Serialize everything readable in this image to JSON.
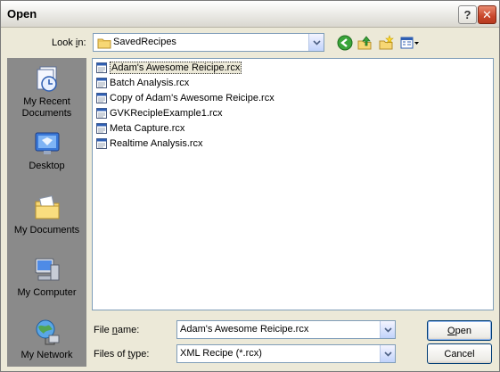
{
  "window": {
    "title": "Open",
    "help_glyph": "?",
    "close_glyph": "✕"
  },
  "look_in": {
    "label_pre": "Look ",
    "label_hot": "i",
    "label_post": "n:",
    "value": "SavedRecipes",
    "icon": "folder-icon"
  },
  "toolbar": {
    "icons": [
      "back-icon",
      "up-folder-icon",
      "new-folder-icon",
      "views-menu-icon"
    ]
  },
  "places": [
    {
      "label_lines": [
        "My Recent",
        "Documents"
      ],
      "icon": "recent-documents-icon"
    },
    {
      "label_lines": [
        "Desktop"
      ],
      "icon": "desktop-icon"
    },
    {
      "label_lines": [
        "My Documents"
      ],
      "icon": "my-documents-icon"
    },
    {
      "label_lines": [
        "My Computer"
      ],
      "icon": "my-computer-icon"
    },
    {
      "label_lines": [
        "My Network"
      ],
      "icon": "my-network-icon"
    }
  ],
  "files": [
    {
      "name": "Adam's Awesome Reicipe.rcx",
      "selected": true
    },
    {
      "name": "Batch Analysis.rcx",
      "selected": false
    },
    {
      "name": "Copy of Adam's Awesome Reicipe.rcx",
      "selected": false
    },
    {
      "name": "GVKRecipleExample1.rcx",
      "selected": false
    },
    {
      "name": "Meta Capture.rcx",
      "selected": false
    },
    {
      "name": "Realtime Analysis.rcx",
      "selected": false
    }
  ],
  "file_name": {
    "label_pre": "File ",
    "label_hot": "n",
    "label_post": "ame:",
    "value": "Adam's Awesome Reicipe.rcx"
  },
  "file_type": {
    "label_pre": "Files of ",
    "label_hot": "t",
    "label_post": "ype:",
    "value": "XML Recipe (*.rcx)"
  },
  "buttons": {
    "open_hot": "O",
    "open_rest": "pen",
    "cancel": "Cancel"
  },
  "colors": {
    "dialog_bg": "#ece9d8",
    "places_bg": "#8a8a8a",
    "field_border": "#7f9db9"
  }
}
